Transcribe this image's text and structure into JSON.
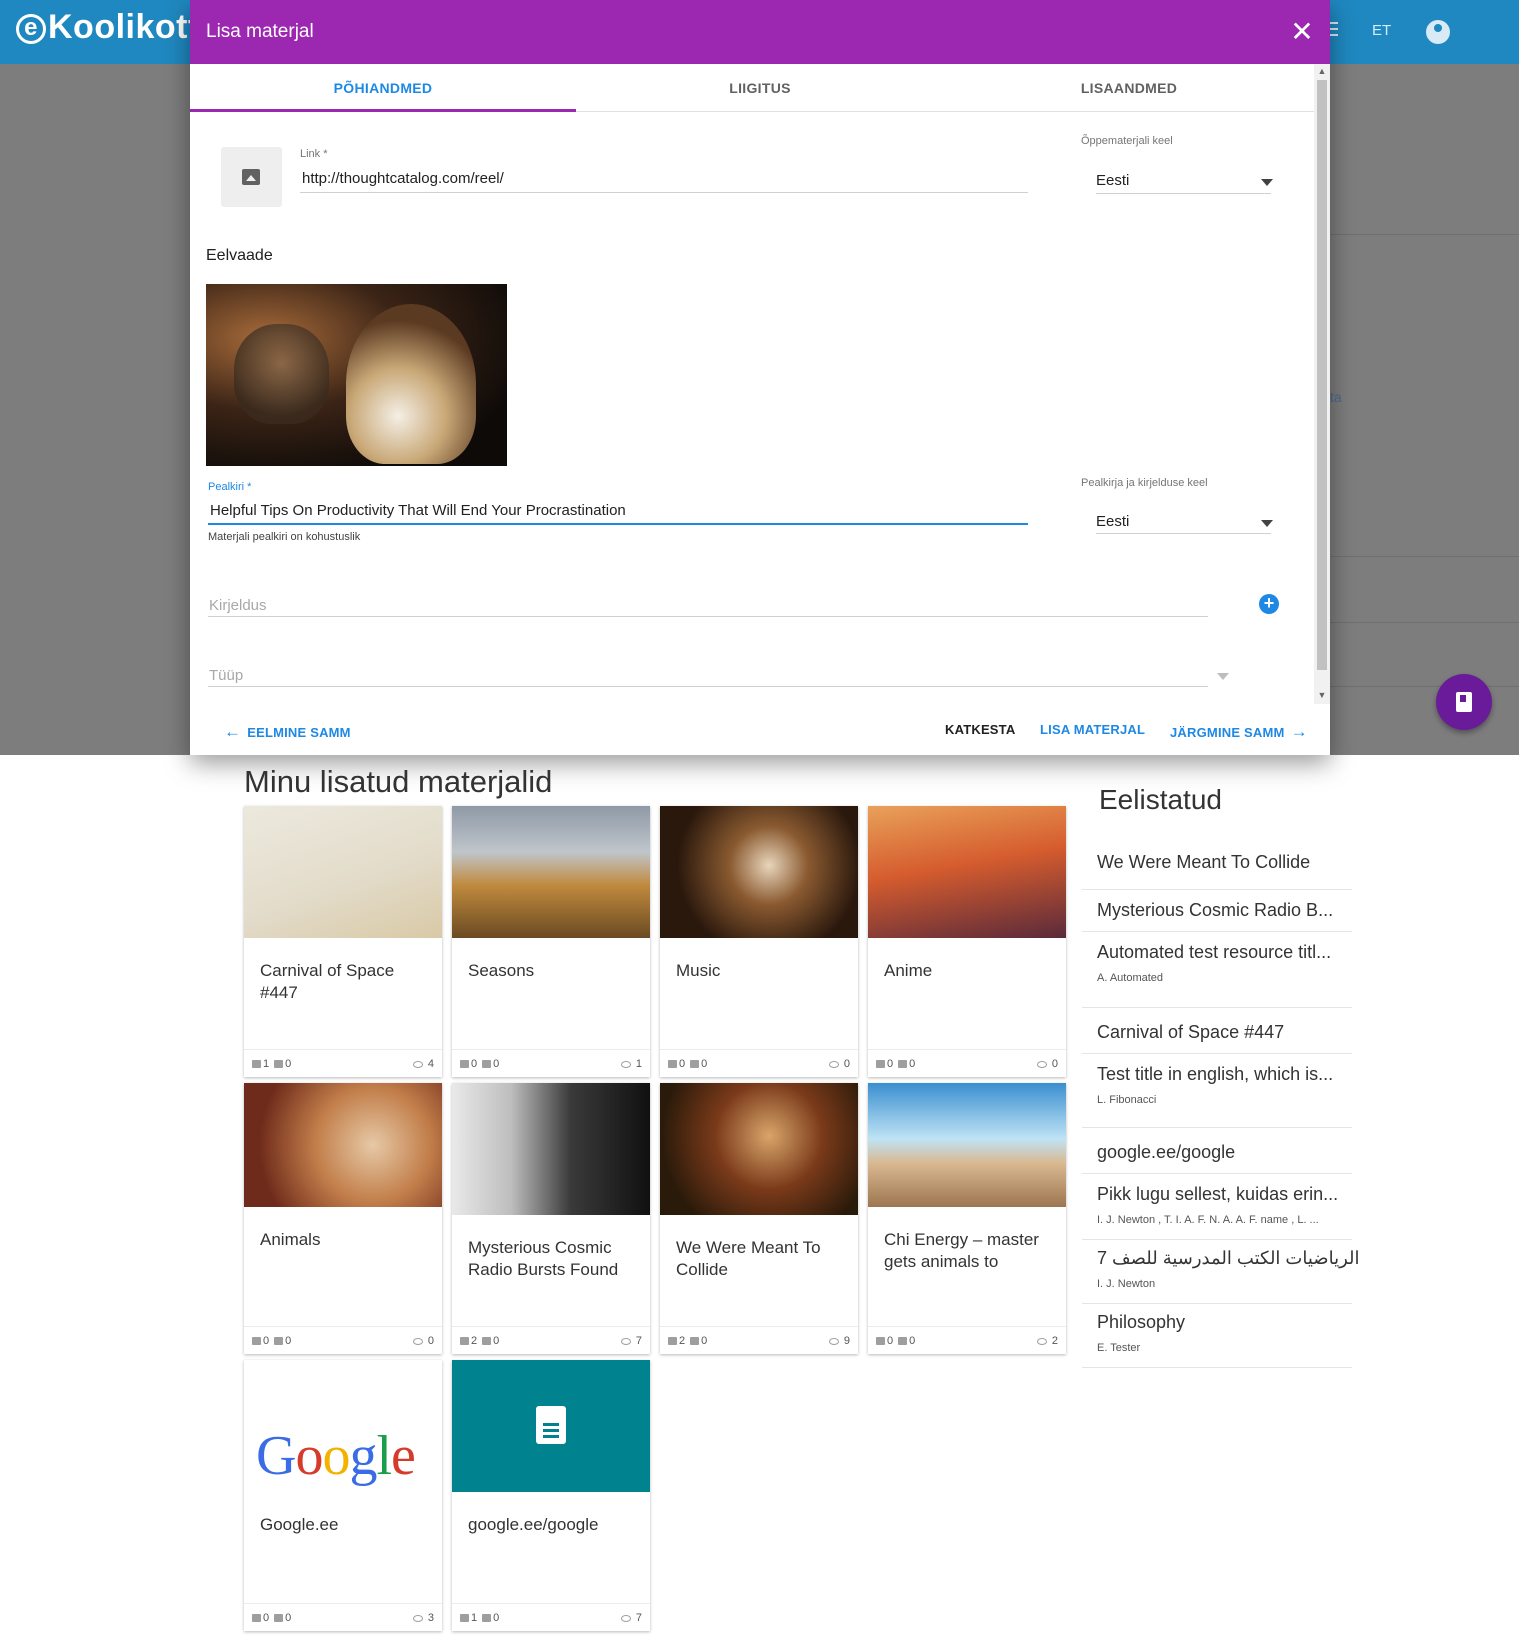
{
  "app": {
    "logo": "Koolikott",
    "lang": "ET"
  },
  "dialog": {
    "title": "Lisa materjal",
    "close_glyph": "✕",
    "tabs": [
      "PÕHIANDMED",
      "LIIGITUS",
      "LISAANDMED"
    ],
    "link": {
      "label": "Link *",
      "value": "http://thoughtcatalog.com/reel/"
    },
    "material_lang": {
      "label": "Õppematerjali keel",
      "value": "Eesti"
    },
    "preview_label": "Eelvaade",
    "title_field": {
      "label": "Pealkiri *",
      "value": "Helpful Tips On Productivity That Will End Your Procrastination",
      "hint": "Materjali pealkiri on kohustuslik"
    },
    "title_lang": {
      "label": "Pealkirja ja kirjelduse keel",
      "value": "Eesti"
    },
    "description_placeholder": "Kirjeldus",
    "type_placeholder": "Tüüp",
    "actions": {
      "prev": "EELMINE SAMM",
      "cancel": "KATKESTA",
      "add": "LISA MATERJAL",
      "next": "JÄRGMINE SAMM"
    }
  },
  "background_fragment": "ta",
  "main": {
    "heading": "Minu lisatud materjalid",
    "cards": [
      {
        "title": "Carnival of Space #447",
        "likes": "1",
        "dislikes": "0",
        "views": "4"
      },
      {
        "title": "Seasons",
        "likes": "0",
        "dislikes": "0",
        "views": "1"
      },
      {
        "title": "Music",
        "likes": "0",
        "dislikes": "0",
        "views": "0"
      },
      {
        "title": "Anime",
        "likes": "0",
        "dislikes": "0",
        "views": "0"
      },
      {
        "title": "Animals",
        "likes": "0",
        "dislikes": "0",
        "views": "0"
      },
      {
        "title": "Mysterious Cosmic Radio Bursts Found",
        "likes": "2",
        "dislikes": "0",
        "views": "7"
      },
      {
        "title": "We Were Meant To Collide",
        "likes": "2",
        "dislikes": "0",
        "views": "9"
      },
      {
        "title": "Chi Energy – master gets animals to",
        "likes": "0",
        "dislikes": "0",
        "views": "2"
      },
      {
        "title": "Google.ee",
        "likes": "0",
        "dislikes": "0",
        "views": "3",
        "logo": "Google"
      },
      {
        "title": "google.ee/google",
        "likes": "1",
        "dislikes": "0",
        "views": "7"
      }
    ]
  },
  "sidebar": {
    "heading": "Eelistatud",
    "items": [
      {
        "title": "We Were Meant To Collide"
      },
      {
        "title": "Mysterious Cosmic Radio B..."
      },
      {
        "title": "Automated test resource titl...",
        "sub": "A. Automated"
      },
      {
        "title": "Carnival of Space #447"
      },
      {
        "title": "Test title in english, which is...",
        "sub": "L. Fibonacci"
      },
      {
        "title": "google.ee/google"
      },
      {
        "title": "Pikk lugu sellest, kuidas erin...",
        "sub": "I. J. Newton , T. I. A. F. N. A. A. F. name , L. ..."
      },
      {
        "title": "الرياضيات الكتب المدرسية للصف 7",
        "sub": "I. J. Newton"
      },
      {
        "title": "Philosophy",
        "sub": "E. Tester"
      }
    ]
  },
  "colors": {
    "appbar": "#1f88c0",
    "dialog_header": "#9c27b0",
    "accent": "#1e88e5",
    "fab": "#6a1b9a",
    "doc_tile": "#00838f"
  },
  "icons": [
    "close-icon",
    "image-icon",
    "dropdown-arrow-icon",
    "add-circle-icon",
    "arrow-back-icon",
    "arrow-forward-icon",
    "thumb-up-icon",
    "thumb-down-icon",
    "eye-icon",
    "document-icon",
    "book-icon",
    "account-icon",
    "menu-icon"
  ]
}
